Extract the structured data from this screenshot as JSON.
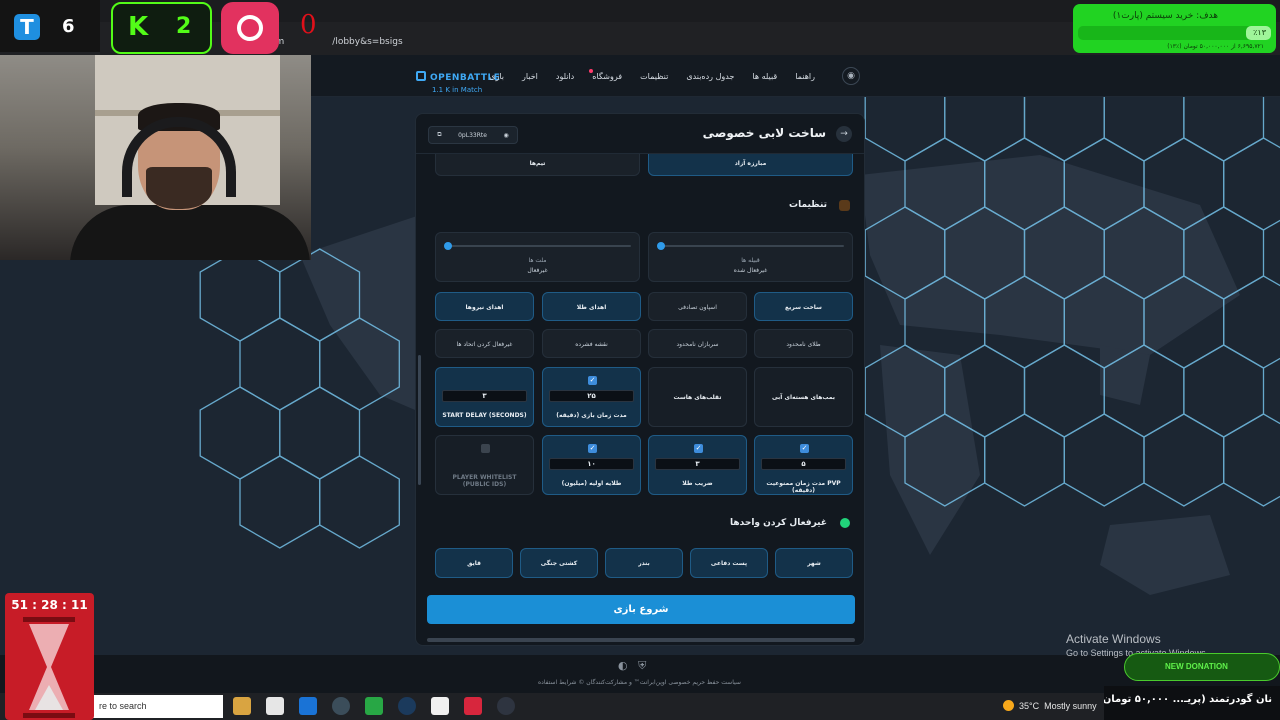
{
  "browser": {
    "url_fragment": "am",
    "url_suffix": "/lobby&s=bsigs"
  },
  "site": {
    "brand": "OPENBATTLE",
    "online": "1.1 K in Match",
    "nav": [
      "راهنما",
      "قبیله ها",
      "جدول رده‌بندی",
      "تنظیمات",
      "فروشگاه",
      "دانلود",
      "اخبار",
      "بازی"
    ]
  },
  "modal": {
    "title": "ساخت لابی خصوصی",
    "lobby_code": "0pL33Rte",
    "mode_tabs": [
      "مبارزه آزاد",
      "تیم‌ها"
    ],
    "settings": {
      "title": "تنظیمات",
      "clan_mode": {
        "label": "قبیله ها",
        "value": "غیرفعال شده"
      },
      "nation_mode": {
        "label": "ملت ها",
        "value": "غیرفعال"
      },
      "toggles": [
        "ساخت سریع",
        "اسپاون تصادفی",
        "اهدای طلا",
        "اهدای نیروها",
        "طلای نامحدود",
        "سربازان نامحدود",
        "نقشه فشرده",
        "غیرفعال کردن اتحاد ها"
      ],
      "toggle_active": [
        true,
        false,
        true,
        true,
        false,
        false,
        false,
        false
      ],
      "numeric": [
        {
          "label": "بمب‌های هسته‌ای آبی",
          "value": ""
        },
        {
          "label": "تقلب‌های هاست",
          "value": ""
        },
        {
          "label": "مدت زمان بازی (دقیقه)",
          "value": "۲۵"
        },
        {
          "label": "START DELAY (SECONDS)",
          "value": "۳"
        },
        {
          "label": "مدت زمان ممنوعیت PVP (دقیقه)",
          "value": "۵"
        },
        {
          "label": "ضریب طلا",
          "value": "۳"
        },
        {
          "label": "طلایه اولیه (میلیون)",
          "value": "۱۰"
        },
        {
          "label": "PLAYER WHITELIST (PUBLIC IDS)",
          "value": ""
        }
      ]
    },
    "units": {
      "title": "غیرفعال کردن واحدها",
      "items": [
        "شهر",
        "پست دفاعی",
        "بندر",
        "کشتی جنگی",
        "قایق"
      ]
    },
    "start_button": "شروع بازی"
  },
  "footer": {
    "links": "سیاست حفظ حریم خصوصی    اوپن‌ابرانت™ و مشارکت‌کنندگان ©    شرایط استفاده"
  },
  "taskbar": {
    "search_placeholder": "re to search",
    "weather_temp": "35°C",
    "weather_text": "Mostly sunny"
  },
  "overlays": {
    "subscriber_count": "6",
    "kick_count": "2",
    "zero_badge": "0",
    "goal_title": "هدف: خرید سیستم (پارت۱)",
    "goal_percent": "٪۱۳",
    "goal_amount": "۶,۶۹۵,۷۲۱ از ۵۰,۰۰۰,۰۰۰ تومان (٪۱۳)",
    "goal_fraction": 0.13,
    "timer": "51 : 28 : 11",
    "activate_title": "Activate Windows",
    "activate_sub": "Go to Settings to activate Windows.",
    "donation_label": "NEW DONATION",
    "donation_ticker": "نان گودرتمند (پریـ... ۵۰,۰۰۰ تومان"
  },
  "colors": {
    "accent": "#1b8fd6",
    "kick_green": "#53fc18",
    "goal_green": "#21d322"
  }
}
